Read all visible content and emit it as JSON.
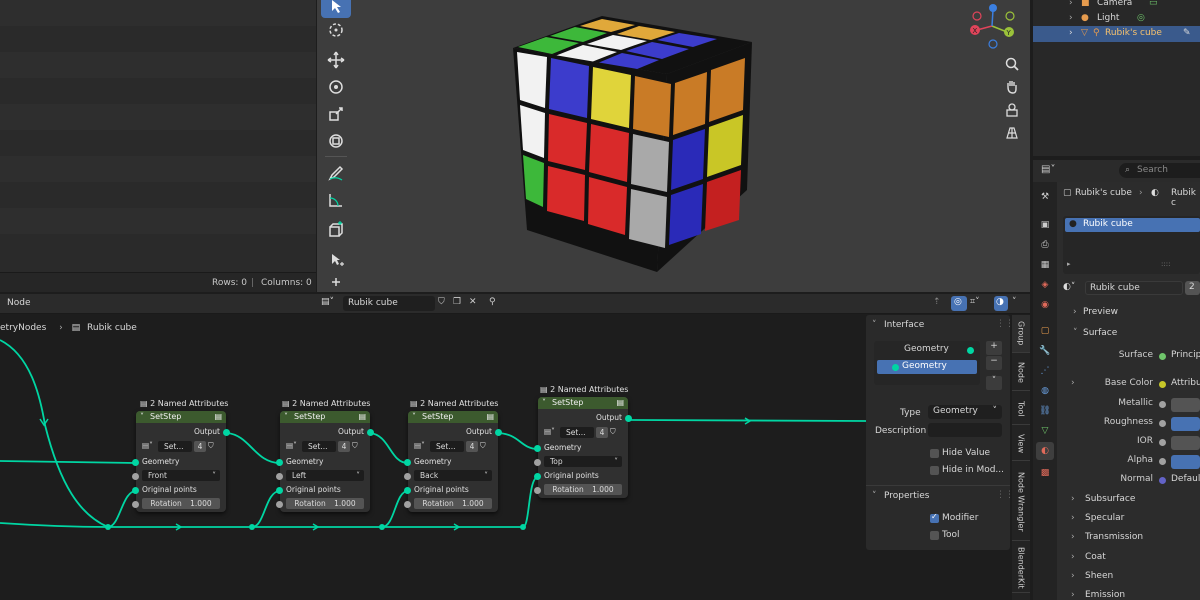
{
  "spreadsheet": {
    "rows_label": "Rows: 0",
    "columns_label": "Columns: 0",
    "divider": "|"
  },
  "outliner": {
    "items": [
      {
        "label": "Camera"
      },
      {
        "label": "Light"
      },
      {
        "label": "Rubik's cube"
      }
    ]
  },
  "properties": {
    "search_placeholder": "Search",
    "breadcrumb_object": "Rubik's cube",
    "breadcrumb_material": "Rubik c",
    "material_slot": "Rubik cube",
    "material_name": "Rubik cube",
    "users_count": "2",
    "preview_label": "Preview",
    "surface_section": "Surface",
    "surface_label": "Surface",
    "surface_value": "Principled",
    "base_color_label": "Base Color",
    "base_color_value": "Attribute",
    "metallic_label": "Metallic",
    "roughness_label": "Roughness",
    "ior_label": "IOR",
    "alpha_label": "Alpha",
    "normal_label": "Normal",
    "normal_value": "Default",
    "sections": [
      "Subsurface",
      "Specular",
      "Transmission",
      "Coat",
      "Sheen",
      "Emission"
    ]
  },
  "node_editor": {
    "menu_label": "Node",
    "tree_name": "Rubik cube",
    "breadcrumb_tree": "etryNodes",
    "breadcrumb_object": "Rubik cube",
    "nodes": [
      {
        "frame_label": "2 Named Attributes",
        "title": "SetStep",
        "output": "Output",
        "group_name": "Set...",
        "users": "4",
        "geometry": "Geometry",
        "dropdown": "Front",
        "original_points": "Original points",
        "rotation_label": "Rotation",
        "rotation_value": "1.000"
      },
      {
        "frame_label": "2 Named Attributes",
        "title": "SetStep",
        "output": "Output",
        "group_name": "Set...",
        "users": "4",
        "geometry": "Geometry",
        "dropdown": "Left",
        "original_points": "Original points",
        "rotation_label": "Rotation",
        "rotation_value": "1.000"
      },
      {
        "frame_label": "2 Named Attributes",
        "title": "SetStep",
        "output": "Output",
        "group_name": "Set...",
        "users": "4",
        "geometry": "Geometry",
        "dropdown": "Back",
        "original_points": "Original points",
        "rotation_label": "Rotation",
        "rotation_value": "1.000"
      },
      {
        "frame_label": "2 Named Attributes",
        "title": "SetStep",
        "output": "Output",
        "group_name": "Set...",
        "users": "4",
        "geometry": "Geometry",
        "dropdown": "Top",
        "original_points": "Original points",
        "rotation_label": "Rotation",
        "rotation_value": "1.000"
      }
    ]
  },
  "n_panel": {
    "interface_title": "Interface",
    "items": [
      "Geometry",
      "Geometry"
    ],
    "type_label": "Type",
    "type_value": "Geometry",
    "description_label": "Description",
    "hide_value_label": "Hide Value",
    "hide_in_modifier_label": "Hide in Mod...",
    "properties_title": "Properties",
    "modifier_label": "Modifier",
    "tool_label": "Tool",
    "tabs": [
      "Group",
      "Node",
      "Tool",
      "View",
      "Node Wrangler",
      "BlenderKit"
    ]
  },
  "colors": {
    "accent": "#4772b3",
    "geometry_socket": "#00d6a3",
    "node_header": "#3c5a2e"
  }
}
